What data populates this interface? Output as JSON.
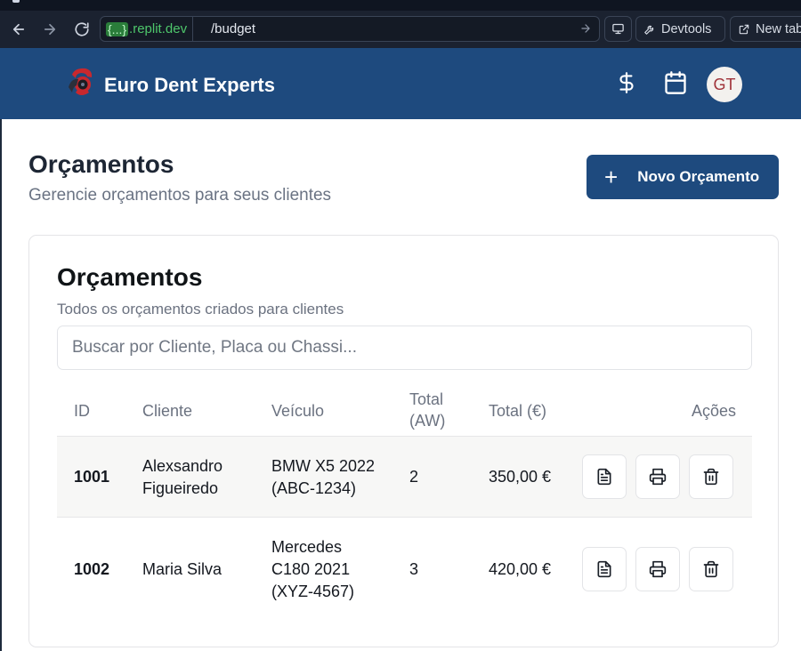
{
  "browser": {
    "url_domain_braces": "{...}",
    "url_domain": ".replit.dev",
    "url_path": "/budget",
    "devtools_label": "Devtools",
    "new_tab_label": "New tab"
  },
  "header": {
    "brand": "Euro Dent Experts",
    "avatar_initials": "GT",
    "icons": [
      "dollar-icon",
      "calendar-icon"
    ]
  },
  "page": {
    "title": "Orçamentos",
    "subtitle": "Gerencie orçamentos para seus clientes",
    "new_button_label": "Novo Orçamento"
  },
  "card": {
    "title": "Orçamentos",
    "subtitle": "Todos os orçamentos criados para clientes",
    "search_placeholder": "Buscar por Cliente, Placa ou Chassi..."
  },
  "table": {
    "headers": {
      "id": "ID",
      "client": "Cliente",
      "vehicle": "Veículo",
      "total_aw_1": "Total",
      "total_aw_2": "(AW)",
      "total_eur": "Total (€)",
      "actions": "Ações"
    },
    "rows": [
      {
        "id": "1001",
        "client_1": "Alexsandro",
        "client_2": "Figueiredo",
        "vehicle_1": "BMW X5 2022",
        "vehicle_2": "(ABC-1234)",
        "total_aw": "2",
        "total_eur": "350,00 €"
      },
      {
        "id": "1002",
        "client_1": "Maria Silva",
        "vehicle_1": "Mercedes",
        "vehicle_2": "C180 2021",
        "vehicle_3": "(XYZ-4567)",
        "total_aw": "3",
        "total_eur": "420,00 €"
      }
    ]
  }
}
